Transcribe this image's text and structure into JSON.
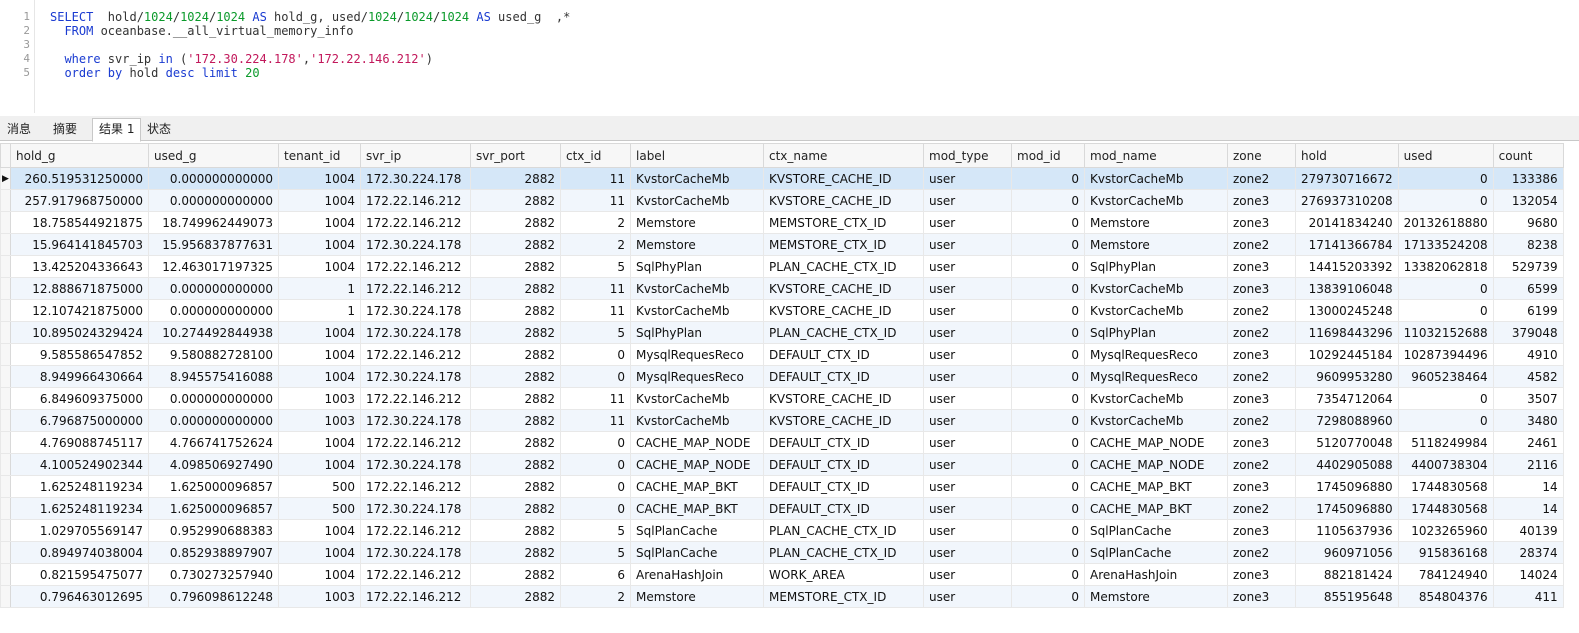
{
  "editor": {
    "lines": [
      {
        "no": "1",
        "tokens": [
          [
            "kw",
            "SELECT  "
          ],
          [
            "t",
            "hold/"
          ],
          [
            "num",
            "1024"
          ],
          [
            "t",
            "/"
          ],
          [
            "num",
            "1024"
          ],
          [
            "t",
            "/"
          ],
          [
            "num",
            "1024"
          ],
          [
            "t",
            " "
          ],
          [
            "kw",
            "AS"
          ],
          [
            "t",
            " hold_g, used/"
          ],
          [
            "num",
            "1024"
          ],
          [
            "t",
            "/"
          ],
          [
            "num",
            "1024"
          ],
          [
            "t",
            "/"
          ],
          [
            "num",
            "1024"
          ],
          [
            "t",
            " "
          ],
          [
            "kw",
            "AS"
          ],
          [
            "t",
            " used_g  ,*"
          ]
        ]
      },
      {
        "no": "2",
        "tokens": [
          [
            "kw",
            "  FROM"
          ],
          [
            "t",
            " oceanbase.__all_virtual_memory_info"
          ]
        ]
      },
      {
        "no": "3",
        "tokens": []
      },
      {
        "no": "4",
        "tokens": [
          [
            "kw",
            "  where"
          ],
          [
            "t",
            " svr_ip "
          ],
          [
            "kw",
            "in"
          ],
          [
            "t",
            " ("
          ],
          [
            "str",
            "'172.30.224.178'"
          ],
          [
            "t",
            ","
          ],
          [
            "str",
            "'172.22.146.212'"
          ],
          [
            "t",
            ")"
          ]
        ]
      },
      {
        "no": "5",
        "tokens": [
          [
            "kw",
            "  order by"
          ],
          [
            "t",
            " hold "
          ],
          [
            "kw",
            "desc limit"
          ],
          [
            "t",
            " "
          ],
          [
            "num",
            "20"
          ]
        ]
      }
    ]
  },
  "tabs": [
    "消息",
    "摘要",
    "结果 1",
    "状态"
  ],
  "active_tab": 2,
  "grid": {
    "columns": [
      "hold_g",
      "used_g",
      "tenant_id",
      "svr_ip",
      "svr_port",
      "ctx_id",
      "label",
      "ctx_name",
      "mod_type",
      "mod_id",
      "mod_name",
      "zone",
      "hold",
      "used",
      "count"
    ],
    "rows": [
      [
        "260.519531250000",
        "0.000000000000",
        "1004",
        "172.30.224.178",
        "2882",
        "11",
        "KvstorCacheMb",
        "KVSTORE_CACHE_ID",
        "user",
        "0",
        "KvstorCacheMb",
        "zone2",
        "279730716672",
        "0",
        "133386"
      ],
      [
        "257.917968750000",
        "0.000000000000",
        "1004",
        "172.22.146.212",
        "2882",
        "11",
        "KvstorCacheMb",
        "KVSTORE_CACHE_ID",
        "user",
        "0",
        "KvstorCacheMb",
        "zone3",
        "276937310208",
        "0",
        "132054"
      ],
      [
        "18.758544921875",
        "18.749962449073",
        "1004",
        "172.22.146.212",
        "2882",
        "2",
        "Memstore",
        "MEMSTORE_CTX_ID",
        "user",
        "0",
        "Memstore",
        "zone3",
        "20141834240",
        "20132618880",
        "9680"
      ],
      [
        "15.964141845703",
        "15.956837877631",
        "1004",
        "172.30.224.178",
        "2882",
        "2",
        "Memstore",
        "MEMSTORE_CTX_ID",
        "user",
        "0",
        "Memstore",
        "zone2",
        "17141366784",
        "17133524208",
        "8238"
      ],
      [
        "13.425204336643",
        "12.463017197325",
        "1004",
        "172.22.146.212",
        "2882",
        "5",
        "SqlPhyPlan",
        "PLAN_CACHE_CTX_ID",
        "user",
        "0",
        "SqlPhyPlan",
        "zone3",
        "14415203392",
        "13382062818",
        "529739"
      ],
      [
        "12.888671875000",
        "0.000000000000",
        "1",
        "172.22.146.212",
        "2882",
        "11",
        "KvstorCacheMb",
        "KVSTORE_CACHE_ID",
        "user",
        "0",
        "KvstorCacheMb",
        "zone3",
        "13839106048",
        "0",
        "6599"
      ],
      [
        "12.107421875000",
        "0.000000000000",
        "1",
        "172.30.224.178",
        "2882",
        "11",
        "KvstorCacheMb",
        "KVSTORE_CACHE_ID",
        "user",
        "0",
        "KvstorCacheMb",
        "zone2",
        "13000245248",
        "0",
        "6199"
      ],
      [
        "10.895024329424",
        "10.274492844938",
        "1004",
        "172.30.224.178",
        "2882",
        "5",
        "SqlPhyPlan",
        "PLAN_CACHE_CTX_ID",
        "user",
        "0",
        "SqlPhyPlan",
        "zone2",
        "11698443296",
        "11032152688",
        "379048"
      ],
      [
        "9.585586547852",
        "9.580882728100",
        "1004",
        "172.22.146.212",
        "2882",
        "0",
        "MysqlRequesReco",
        "DEFAULT_CTX_ID",
        "user",
        "0",
        "MysqlRequesReco",
        "zone3",
        "10292445184",
        "10287394496",
        "4910"
      ],
      [
        "8.949966430664",
        "8.945575416088",
        "1004",
        "172.30.224.178",
        "2882",
        "0",
        "MysqlRequesReco",
        "DEFAULT_CTX_ID",
        "user",
        "0",
        "MysqlRequesReco",
        "zone2",
        "9609953280",
        "9605238464",
        "4582"
      ],
      [
        "6.849609375000",
        "0.000000000000",
        "1003",
        "172.22.146.212",
        "2882",
        "11",
        "KvstorCacheMb",
        "KVSTORE_CACHE_ID",
        "user",
        "0",
        "KvstorCacheMb",
        "zone3",
        "7354712064",
        "0",
        "3507"
      ],
      [
        "6.796875000000",
        "0.000000000000",
        "1003",
        "172.30.224.178",
        "2882",
        "11",
        "KvstorCacheMb",
        "KVSTORE_CACHE_ID",
        "user",
        "0",
        "KvstorCacheMb",
        "zone2",
        "7298088960",
        "0",
        "3480"
      ],
      [
        "4.769088745117",
        "4.766741752624",
        "1004",
        "172.22.146.212",
        "2882",
        "0",
        "CACHE_MAP_NODE",
        "DEFAULT_CTX_ID",
        "user",
        "0",
        "CACHE_MAP_NODE",
        "zone3",
        "5120770048",
        "5118249984",
        "2461"
      ],
      [
        "4.100524902344",
        "4.098506927490",
        "1004",
        "172.30.224.178",
        "2882",
        "0",
        "CACHE_MAP_NODE",
        "DEFAULT_CTX_ID",
        "user",
        "0",
        "CACHE_MAP_NODE",
        "zone2",
        "4402905088",
        "4400738304",
        "2116"
      ],
      [
        "1.625248119234",
        "1.625000096857",
        "500",
        "172.22.146.212",
        "2882",
        "0",
        "CACHE_MAP_BKT",
        "DEFAULT_CTX_ID",
        "user",
        "0",
        "CACHE_MAP_BKT",
        "zone3",
        "1745096880",
        "1744830568",
        "14"
      ],
      [
        "1.625248119234",
        "1.625000096857",
        "500",
        "172.30.224.178",
        "2882",
        "0",
        "CACHE_MAP_BKT",
        "DEFAULT_CTX_ID",
        "user",
        "0",
        "CACHE_MAP_BKT",
        "zone2",
        "1745096880",
        "1744830568",
        "14"
      ],
      [
        "1.029705569147",
        "0.952990688383",
        "1004",
        "172.22.146.212",
        "2882",
        "5",
        "SqlPlanCache",
        "PLAN_CACHE_CTX_ID",
        "user",
        "0",
        "SqlPlanCache",
        "zone3",
        "1105637936",
        "1023265960",
        "40139"
      ],
      [
        "0.894974038004",
        "0.852938897907",
        "1004",
        "172.30.224.178",
        "2882",
        "5",
        "SqlPlanCache",
        "PLAN_CACHE_CTX_ID",
        "user",
        "0",
        "SqlPlanCache",
        "zone2",
        "960971056",
        "915836168",
        "28374"
      ],
      [
        "0.821595475077",
        "0.730273257940",
        "1004",
        "172.22.146.212",
        "2882",
        "6",
        "ArenaHashJoin",
        "WORK_AREA",
        "user",
        "0",
        "ArenaHashJoin",
        "zone3",
        "882181424",
        "784124940",
        "14024"
      ],
      [
        "0.796463012695",
        "0.796098612248",
        "1003",
        "172.22.146.212",
        "2882",
        "2",
        "Memstore",
        "MEMSTORE_CTX_ID",
        "user",
        "0",
        "Memstore",
        "zone3",
        "855195648",
        "854804376",
        "411"
      ]
    ],
    "selected_row": 0,
    "row_indicator_icon": "row-pointer-icon"
  }
}
